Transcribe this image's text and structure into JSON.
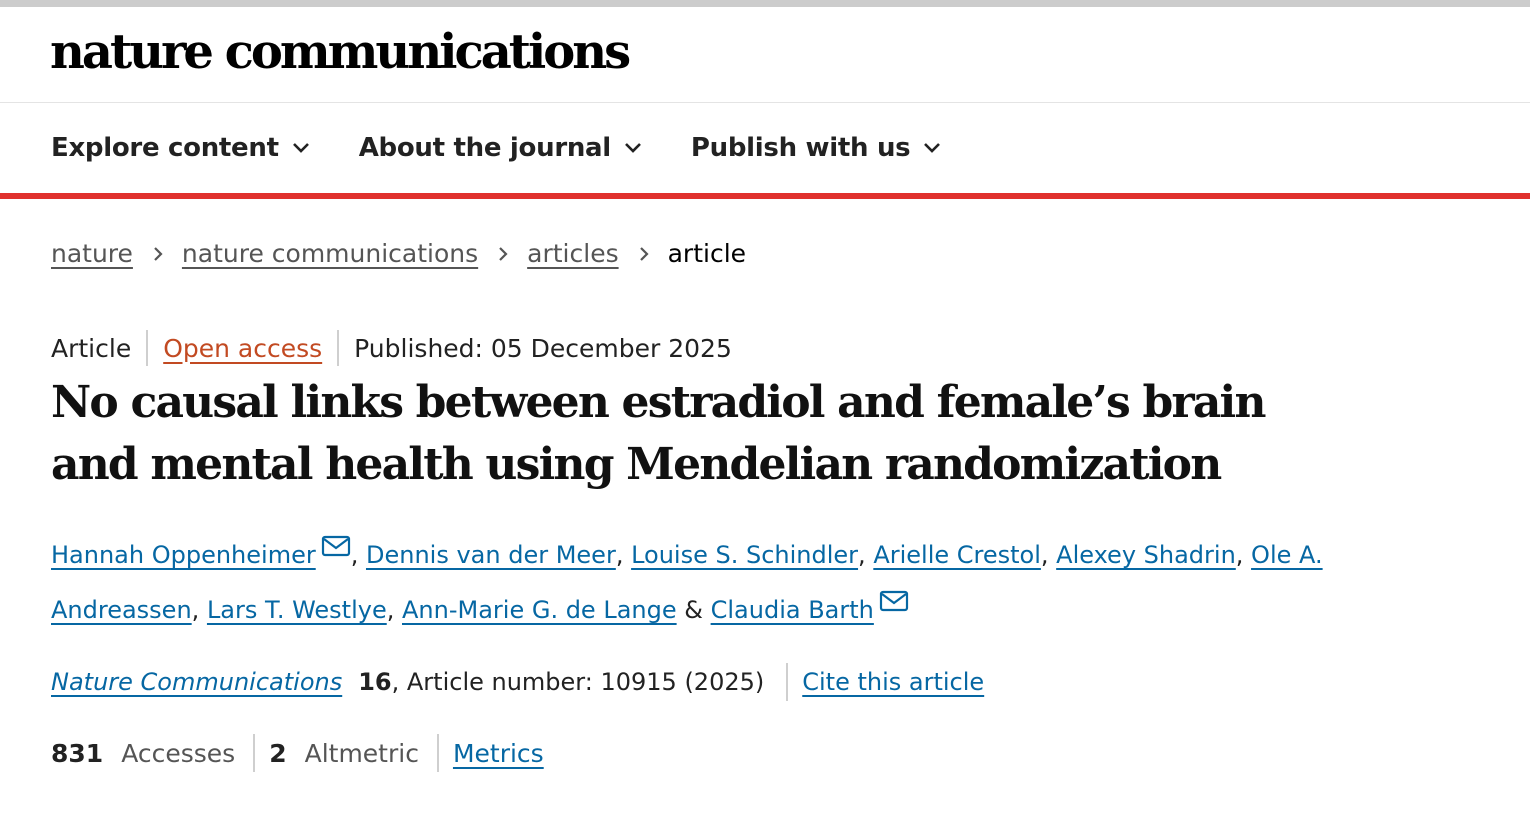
{
  "site": {
    "logo_text": "nature communications"
  },
  "nav": {
    "items": [
      {
        "label": "Explore content",
        "icon": "chevron-down-icon"
      },
      {
        "label": "About the journal",
        "icon": "chevron-down-icon"
      },
      {
        "label": "Publish with us",
        "icon": "chevron-down-icon"
      }
    ]
  },
  "breadcrumb": {
    "items": [
      {
        "label": "nature"
      },
      {
        "label": "nature communications"
      },
      {
        "label": "articles"
      }
    ],
    "current": "article"
  },
  "article": {
    "type": "Article",
    "access": "Open access",
    "published": "Published: 05 December 2025",
    "title": "No causal links between estradiol and female’s brain and mental health using Mendelian randomization",
    "authors": [
      {
        "name": "Hannah Oppenheimer",
        "mail": true,
        "sep": ", "
      },
      {
        "name": "Dennis van der Meer",
        "mail": false,
        "sep": ", "
      },
      {
        "name": "Louise S. Schindler",
        "mail": false,
        "sep": ", "
      },
      {
        "name": "Arielle Crestol",
        "mail": false,
        "sep": ", "
      },
      {
        "name": "Alexey Shadrin",
        "mail": false,
        "sep": ", "
      },
      {
        "name": "Ole A. Andreassen",
        "mail": false,
        "sep": ", "
      },
      {
        "name": "Lars T. Westlye",
        "mail": false,
        "sep": ", "
      },
      {
        "name": "Ann-Marie G. de Lange",
        "mail": false,
        "sep": " & "
      },
      {
        "name": "Claudia Barth",
        "mail": true,
        "sep": ""
      }
    ]
  },
  "citation": {
    "journal": "Nature Communications",
    "volume": "16",
    "article_number": ", Article number: 10915 (2025)",
    "cite_label": "Cite this article"
  },
  "metrics": {
    "accesses_count": "831",
    "accesses_label": "Accesses",
    "altmetric_count": "2",
    "altmetric_label": "Altmetric",
    "metrics_link": "Metrics"
  },
  "colors": {
    "accent_red": "#e0312d",
    "link_blue": "#0667a3",
    "open_access": "#c24a22"
  }
}
